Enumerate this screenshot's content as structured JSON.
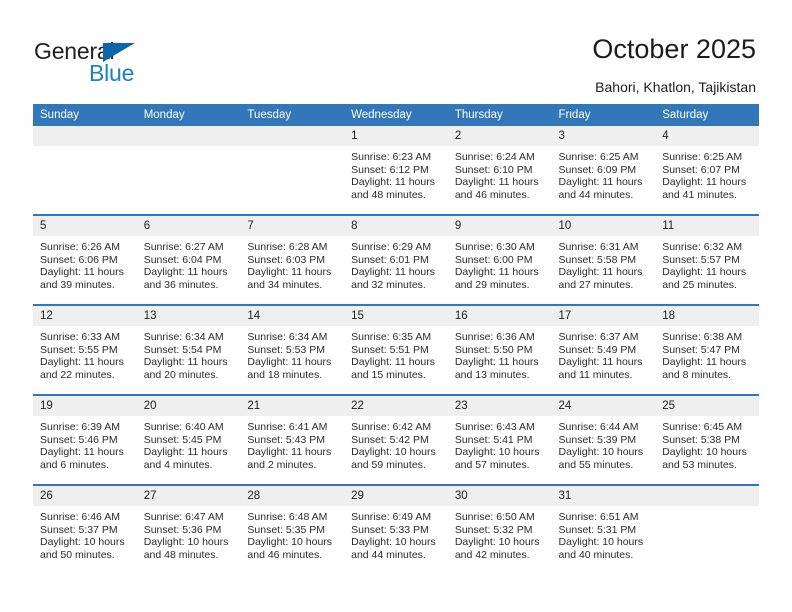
{
  "brand": {
    "name_top": "General",
    "name_bottom": "Blue",
    "logo_color": "#1f7fc4",
    "triangle_color": "#0c65ad"
  },
  "header": {
    "title": "October 2025",
    "subtitle": "Bahori, Khatlon, Tajikistan"
  },
  "theme": {
    "header_blue": "#3277b9",
    "date_band": "#efefef",
    "text": "#2b2b2b"
  },
  "calendar": {
    "weekday_headers": [
      "Sunday",
      "Monday",
      "Tuesday",
      "Wednesday",
      "Thursday",
      "Friday",
      "Saturday"
    ],
    "weeks": [
      [
        {
          "day": "",
          "sunrise": "",
          "sunset": "",
          "daylight_line1": "",
          "daylight_line2": ""
        },
        {
          "day": "",
          "sunrise": "",
          "sunset": "",
          "daylight_line1": "",
          "daylight_line2": ""
        },
        {
          "day": "",
          "sunrise": "",
          "sunset": "",
          "daylight_line1": "",
          "daylight_line2": ""
        },
        {
          "day": "1",
          "sunrise": "Sunrise: 6:23 AM",
          "sunset": "Sunset: 6:12 PM",
          "daylight_line1": "Daylight: 11 hours",
          "daylight_line2": "and 48 minutes."
        },
        {
          "day": "2",
          "sunrise": "Sunrise: 6:24 AM",
          "sunset": "Sunset: 6:10 PM",
          "daylight_line1": "Daylight: 11 hours",
          "daylight_line2": "and 46 minutes."
        },
        {
          "day": "3",
          "sunrise": "Sunrise: 6:25 AM",
          "sunset": "Sunset: 6:09 PM",
          "daylight_line1": "Daylight: 11 hours",
          "daylight_line2": "and 44 minutes."
        },
        {
          "day": "4",
          "sunrise": "Sunrise: 6:25 AM",
          "sunset": "Sunset: 6:07 PM",
          "daylight_line1": "Daylight: 11 hours",
          "daylight_line2": "and 41 minutes."
        }
      ],
      [
        {
          "day": "5",
          "sunrise": "Sunrise: 6:26 AM",
          "sunset": "Sunset: 6:06 PM",
          "daylight_line1": "Daylight: 11 hours",
          "daylight_line2": "and 39 minutes."
        },
        {
          "day": "6",
          "sunrise": "Sunrise: 6:27 AM",
          "sunset": "Sunset: 6:04 PM",
          "daylight_line1": "Daylight: 11 hours",
          "daylight_line2": "and 36 minutes."
        },
        {
          "day": "7",
          "sunrise": "Sunrise: 6:28 AM",
          "sunset": "Sunset: 6:03 PM",
          "daylight_line1": "Daylight: 11 hours",
          "daylight_line2": "and 34 minutes."
        },
        {
          "day": "8",
          "sunrise": "Sunrise: 6:29 AM",
          "sunset": "Sunset: 6:01 PM",
          "daylight_line1": "Daylight: 11 hours",
          "daylight_line2": "and 32 minutes."
        },
        {
          "day": "9",
          "sunrise": "Sunrise: 6:30 AM",
          "sunset": "Sunset: 6:00 PM",
          "daylight_line1": "Daylight: 11 hours",
          "daylight_line2": "and 29 minutes."
        },
        {
          "day": "10",
          "sunrise": "Sunrise: 6:31 AM",
          "sunset": "Sunset: 5:58 PM",
          "daylight_line1": "Daylight: 11 hours",
          "daylight_line2": "and 27 minutes."
        },
        {
          "day": "11",
          "sunrise": "Sunrise: 6:32 AM",
          "sunset": "Sunset: 5:57 PM",
          "daylight_line1": "Daylight: 11 hours",
          "daylight_line2": "and 25 minutes."
        }
      ],
      [
        {
          "day": "12",
          "sunrise": "Sunrise: 6:33 AM",
          "sunset": "Sunset: 5:55 PM",
          "daylight_line1": "Daylight: 11 hours",
          "daylight_line2": "and 22 minutes."
        },
        {
          "day": "13",
          "sunrise": "Sunrise: 6:34 AM",
          "sunset": "Sunset: 5:54 PM",
          "daylight_line1": "Daylight: 11 hours",
          "daylight_line2": "and 20 minutes."
        },
        {
          "day": "14",
          "sunrise": "Sunrise: 6:34 AM",
          "sunset": "Sunset: 5:53 PM",
          "daylight_line1": "Daylight: 11 hours",
          "daylight_line2": "and 18 minutes."
        },
        {
          "day": "15",
          "sunrise": "Sunrise: 6:35 AM",
          "sunset": "Sunset: 5:51 PM",
          "daylight_line1": "Daylight: 11 hours",
          "daylight_line2": "and 15 minutes."
        },
        {
          "day": "16",
          "sunrise": "Sunrise: 6:36 AM",
          "sunset": "Sunset: 5:50 PM",
          "daylight_line1": "Daylight: 11 hours",
          "daylight_line2": "and 13 minutes."
        },
        {
          "day": "17",
          "sunrise": "Sunrise: 6:37 AM",
          "sunset": "Sunset: 5:49 PM",
          "daylight_line1": "Daylight: 11 hours",
          "daylight_line2": "and 11 minutes."
        },
        {
          "day": "18",
          "sunrise": "Sunrise: 6:38 AM",
          "sunset": "Sunset: 5:47 PM",
          "daylight_line1": "Daylight: 11 hours",
          "daylight_line2": "and 8 minutes."
        }
      ],
      [
        {
          "day": "19",
          "sunrise": "Sunrise: 6:39 AM",
          "sunset": "Sunset: 5:46 PM",
          "daylight_line1": "Daylight: 11 hours",
          "daylight_line2": "and 6 minutes."
        },
        {
          "day": "20",
          "sunrise": "Sunrise: 6:40 AM",
          "sunset": "Sunset: 5:45 PM",
          "daylight_line1": "Daylight: 11 hours",
          "daylight_line2": "and 4 minutes."
        },
        {
          "day": "21",
          "sunrise": "Sunrise: 6:41 AM",
          "sunset": "Sunset: 5:43 PM",
          "daylight_line1": "Daylight: 11 hours",
          "daylight_line2": "and 2 minutes."
        },
        {
          "day": "22",
          "sunrise": "Sunrise: 6:42 AM",
          "sunset": "Sunset: 5:42 PM",
          "daylight_line1": "Daylight: 10 hours",
          "daylight_line2": "and 59 minutes."
        },
        {
          "day": "23",
          "sunrise": "Sunrise: 6:43 AM",
          "sunset": "Sunset: 5:41 PM",
          "daylight_line1": "Daylight: 10 hours",
          "daylight_line2": "and 57 minutes."
        },
        {
          "day": "24",
          "sunrise": "Sunrise: 6:44 AM",
          "sunset": "Sunset: 5:39 PM",
          "daylight_line1": "Daylight: 10 hours",
          "daylight_line2": "and 55 minutes."
        },
        {
          "day": "25",
          "sunrise": "Sunrise: 6:45 AM",
          "sunset": "Sunset: 5:38 PM",
          "daylight_line1": "Daylight: 10 hours",
          "daylight_line2": "and 53 minutes."
        }
      ],
      [
        {
          "day": "26",
          "sunrise": "Sunrise: 6:46 AM",
          "sunset": "Sunset: 5:37 PM",
          "daylight_line1": "Daylight: 10 hours",
          "daylight_line2": "and 50 minutes."
        },
        {
          "day": "27",
          "sunrise": "Sunrise: 6:47 AM",
          "sunset": "Sunset: 5:36 PM",
          "daylight_line1": "Daylight: 10 hours",
          "daylight_line2": "and 48 minutes."
        },
        {
          "day": "28",
          "sunrise": "Sunrise: 6:48 AM",
          "sunset": "Sunset: 5:35 PM",
          "daylight_line1": "Daylight: 10 hours",
          "daylight_line2": "and 46 minutes."
        },
        {
          "day": "29",
          "sunrise": "Sunrise: 6:49 AM",
          "sunset": "Sunset: 5:33 PM",
          "daylight_line1": "Daylight: 10 hours",
          "daylight_line2": "and 44 minutes."
        },
        {
          "day": "30",
          "sunrise": "Sunrise: 6:50 AM",
          "sunset": "Sunset: 5:32 PM",
          "daylight_line1": "Daylight: 10 hours",
          "daylight_line2": "and 42 minutes."
        },
        {
          "day": "31",
          "sunrise": "Sunrise: 6:51 AM",
          "sunset": "Sunset: 5:31 PM",
          "daylight_line1": "Daylight: 10 hours",
          "daylight_line2": "and 40 minutes."
        },
        {
          "day": "",
          "sunrise": "",
          "sunset": "",
          "daylight_line1": "",
          "daylight_line2": ""
        }
      ]
    ]
  }
}
